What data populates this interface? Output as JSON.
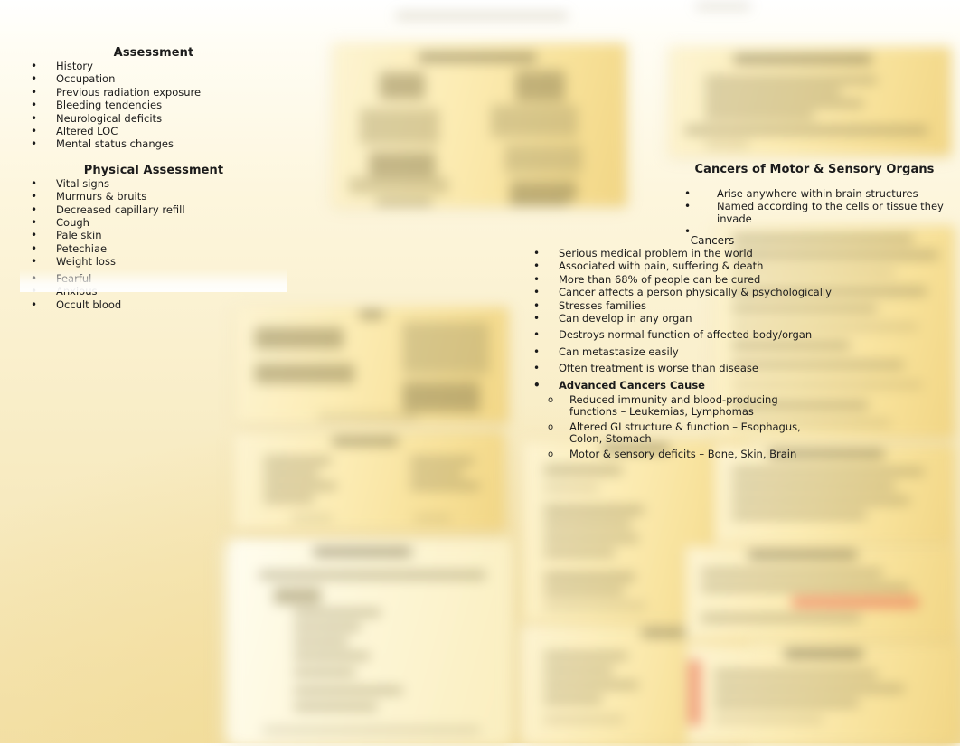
{
  "page": {
    "background_color": "#fdf6dd",
    "accent_color": "#f2d98e",
    "highlight_color": "#e8795c"
  },
  "panels": {
    "assessment": {
      "title": "Assessment",
      "items": [
        "History",
        "Occupation",
        "Previous radiation exposure",
        "Bleeding tendencies",
        "Neurological deficits",
        "Altered LOC",
        "Mental status changes"
      ],
      "subtitle": "Physical Assessment",
      "physical_items": [
        "Vital signs",
        "Murmurs & bruits",
        "Decreased capillary refill",
        "Cough",
        "Pale skin",
        "Petechiae",
        "Weight loss",
        "Fearful",
        "Anxious",
        "Occult blood"
      ]
    },
    "motor_sensory": {
      "title": "Cancers of Motor & Sensory Organs",
      "items": [
        "Arise anywhere within brain structures",
        "Named according to the cells or tissue they invade",
        ""
      ]
    },
    "cancers": {
      "title": "Cancers",
      "items": [
        "Serious medical problem in the world",
        "Associated with pain, suffering & death",
        "More than 68% of people can be cured",
        "Cancer affects a person physically & psychologically",
        "Stresses families",
        "Can develop in any organ",
        "Destroys normal function of affected body/organ",
        "Can metastasize easily",
        "Often treatment is worse than disease"
      ],
      "advanced_label": "Advanced Cancers Cause",
      "advanced_items": [
        {
          "line1": "Reduced immunity and blood-producing",
          "line2": "functions – Leukemias, Lymphomas"
        },
        {
          "line1": "Altered GI structure & function – Esophagus,",
          "line2": "Colon, Stomach"
        },
        {
          "line1": "Motor & sensory deficits – Bone, Skin, Brain",
          "line2": ""
        }
      ]
    }
  }
}
